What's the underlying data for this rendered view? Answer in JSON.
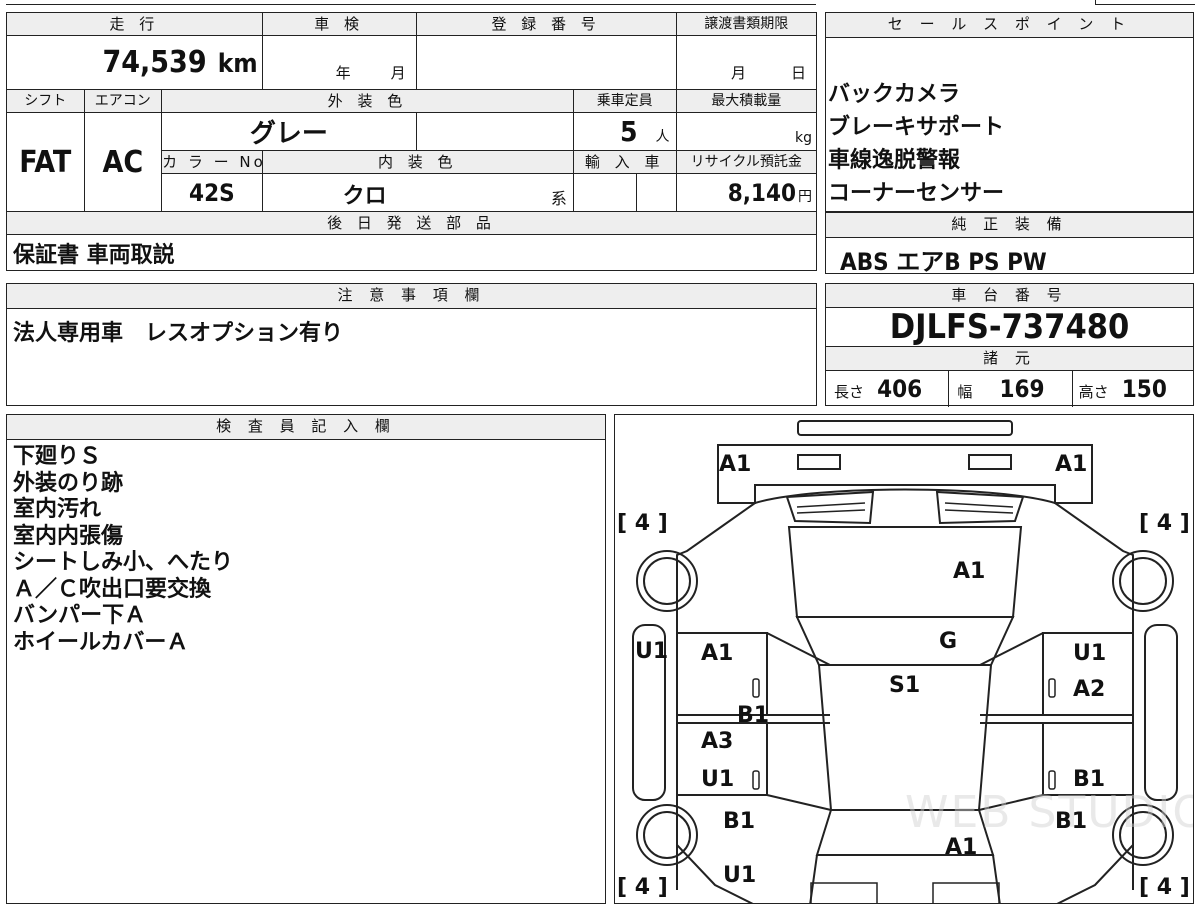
{
  "top_grid": {
    "mileage_label": "走 行",
    "mileage_value": "74,539",
    "mileage_unit": "km",
    "inspection_label": "車 検",
    "inspection_year": "年",
    "inspection_month": "月",
    "registration_label": "登 録 番 号",
    "transfer_label": "譲渡書類期限",
    "transfer_month": "月",
    "transfer_day": "日",
    "shift_label": "シフト",
    "aircon_label": "エアコン",
    "exterior_color_label": "外 装 色",
    "capacity_label": "乗車定員",
    "max_load_label": "最大積載量",
    "shift_value": "FAT",
    "aircon_value": "AC",
    "exterior_color_value": "グレー",
    "capacity_value": "5",
    "capacity_unit": "人",
    "max_load_unit": "kg",
    "color_no_label": "カ ラ ー No.",
    "interior_color_label": "内 装 色",
    "import_label": "輸 入 車",
    "recycle_label": "リサイクル預託金",
    "color_no_value": "42S",
    "interior_color_value": "クロ",
    "interior_color_suffix": "系",
    "recycle_value": "8,140",
    "recycle_unit": "円"
  },
  "later_parts": {
    "label": "後 日 発 送 部 品",
    "value": "保証書 車両取説"
  },
  "notes": {
    "label": "注 意 事 項 欄",
    "value": "法人専用車　レスオプション有り"
  },
  "sales_points": {
    "label": "セ ー ル ス ポ イ ン ト",
    "items": [
      "バックカメラ",
      "ブレーキサポート",
      "車線逸脱警報",
      "コーナーセンサー"
    ]
  },
  "genuine_equipment": {
    "label": "純 正 装 備",
    "value": "ABS エアB PS PW"
  },
  "chassis": {
    "label": "車 台 番 号",
    "value": "DJLFS-737480"
  },
  "specs": {
    "label": "諸 元",
    "length_label": "長さ",
    "length_value": "406",
    "width_label": "幅",
    "width_value": "169",
    "height_label": "高さ",
    "height_value": "150"
  },
  "inspector": {
    "label": "検 査 員 記 入 欄",
    "lines": [
      "下廻りＳ",
      "外装のり跡",
      "室内汚れ",
      "室内内張傷",
      "シートしみ小、へたり",
      "Ａ／Ｃ吹出口要交換",
      "バンパー下Ａ",
      "ホイールカバーＡ"
    ]
  },
  "diagram": {
    "tire_left_top": "4",
    "tire_right_top": "4",
    "tire_left_bottom": "4",
    "tire_right_bottom": "4",
    "front_bumper_left": "A1",
    "front_bumper_right": "A1",
    "hood": "A1",
    "windshield": "G",
    "roof": "S1",
    "front_left_fender": "U1",
    "front_left_door": "A1",
    "front_left_mark": "B1",
    "rear_left_door_upper": "A3",
    "rear_left_door_lower": "U1",
    "rear_left_quarter": "B1",
    "rear_left_bottom": "U1",
    "front_right_door": "U1",
    "front_right_fender_mark": "A2",
    "rear_right_door": "B1",
    "rear_right_quarter": "B1",
    "rear_gate": "A1",
    "watermark": "WEB STUDIO"
  }
}
